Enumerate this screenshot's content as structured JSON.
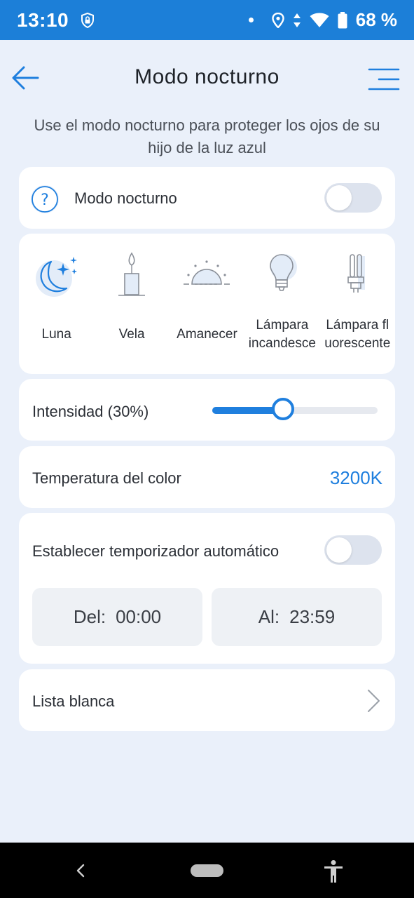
{
  "status_bar": {
    "time": "13:10",
    "battery": "68 %"
  },
  "header": {
    "title": "Modo nocturno"
  },
  "subtitle": "Use el modo nocturno para proteger los ojos de su hijo de la luz azul",
  "night_mode": {
    "label": "Modo nocturno",
    "enabled": false
  },
  "light_modes": [
    {
      "label": "Luna",
      "icon": "moon-stars-icon"
    },
    {
      "label": "Vela",
      "icon": "candle-icon"
    },
    {
      "label": "Amanecer",
      "icon": "sunrise-icon"
    },
    {
      "label": "Lámpara incandesce",
      "icon": "bulb-icon"
    },
    {
      "label": "Lámpara fl uorescente",
      "icon": "fluorescent-lamp-icon"
    }
  ],
  "intensity": {
    "label": "Intensidad (30%)",
    "value": 0.3
  },
  "color_temperature": {
    "label": "Temperatura del color",
    "value": "3200K"
  },
  "timer": {
    "label": "Establecer temporizador automático",
    "enabled": false,
    "from_label": "Del:",
    "from_value": "00:00",
    "to_label": "Al:",
    "to_value": "23:59"
  },
  "whitelist": {
    "label": "Lista blanca"
  },
  "colors": {
    "accent": "#1f7fde",
    "status_bar": "#1c7fd8",
    "background": "#eaf0fa"
  }
}
